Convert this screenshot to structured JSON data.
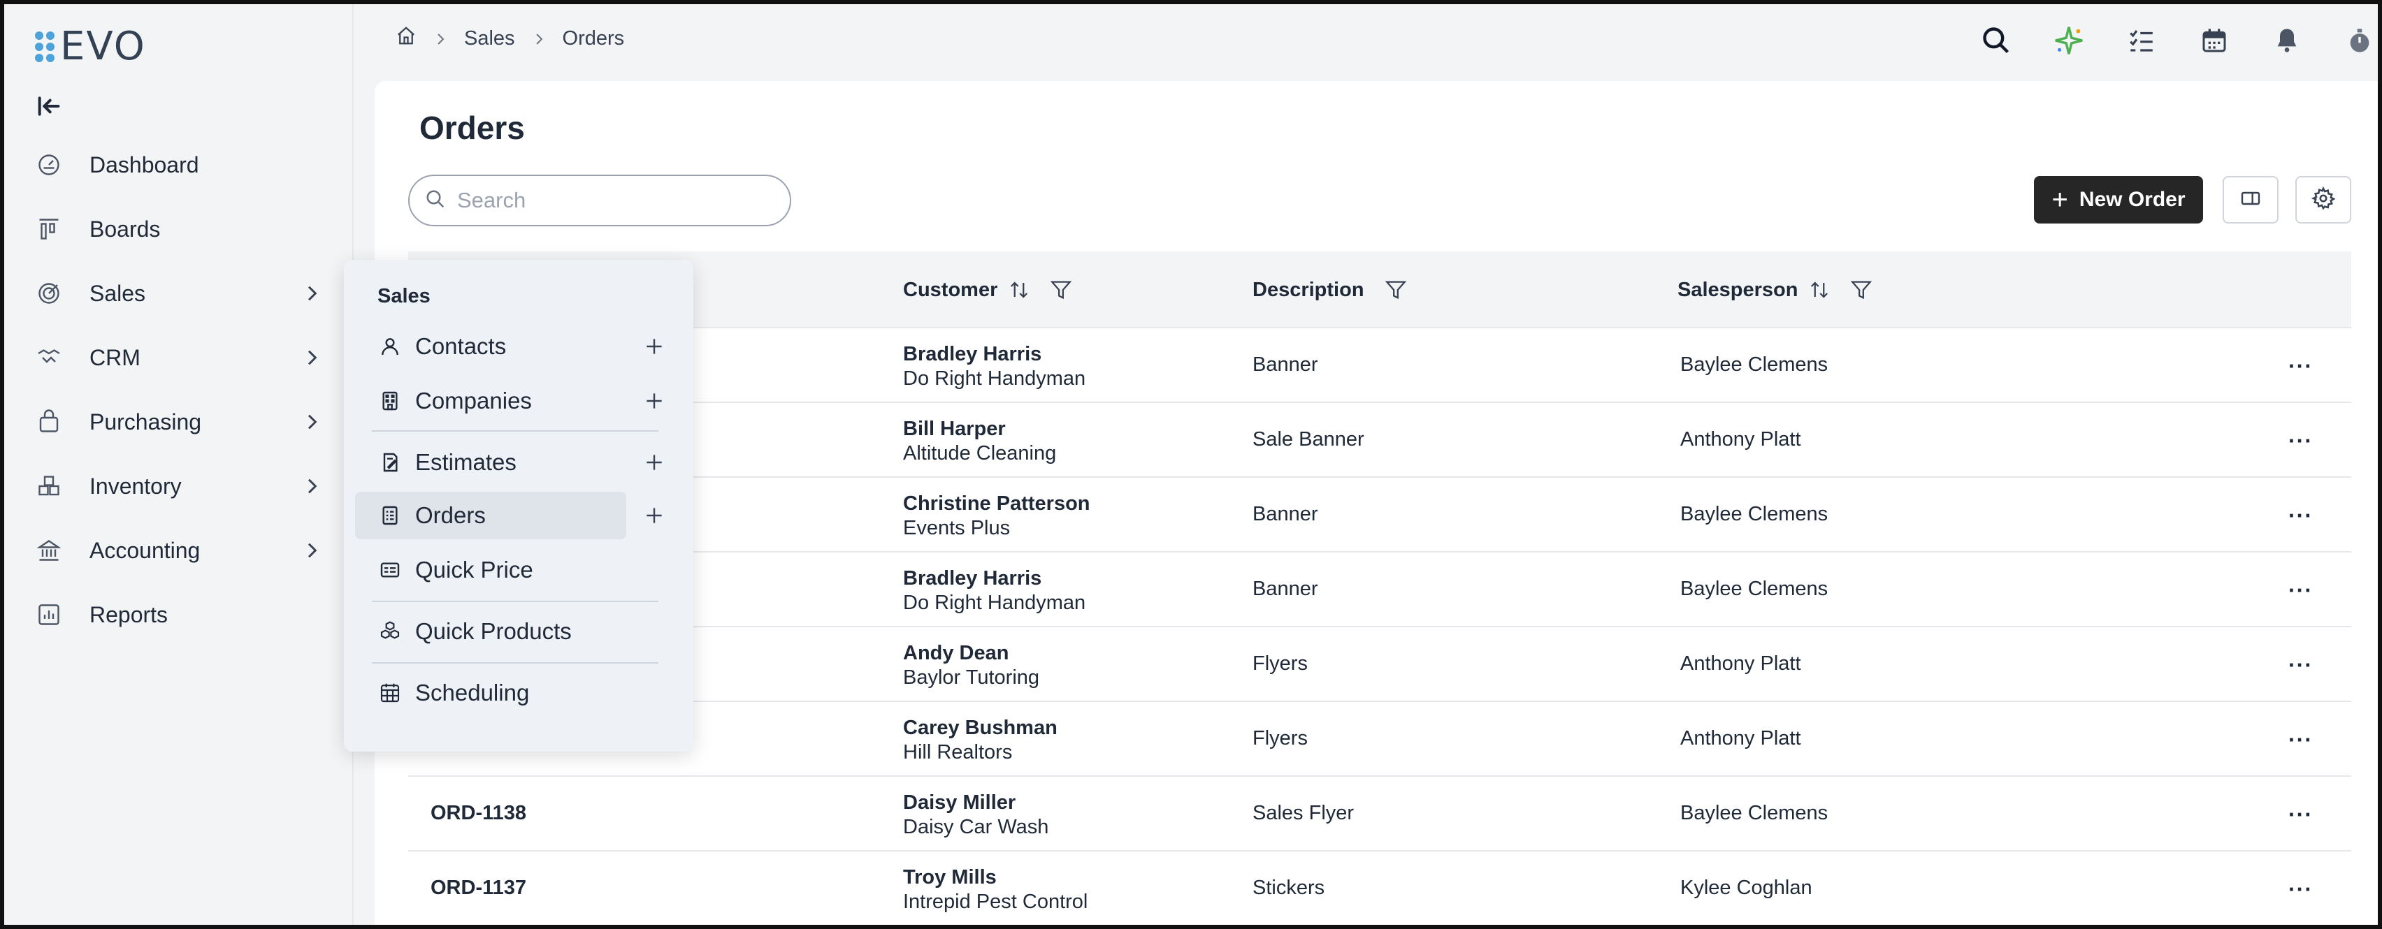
{
  "app": {
    "logo": "EVO"
  },
  "sidebar": {
    "items": [
      {
        "label": "Dashboard",
        "icon": "dashboard-icon"
      },
      {
        "label": "Boards",
        "icon": "boards-icon"
      },
      {
        "label": "Sales",
        "icon": "sales-icon",
        "has_submenu": true
      },
      {
        "label": "CRM",
        "icon": "handshake-icon",
        "has_submenu": true
      },
      {
        "label": "Purchasing",
        "icon": "shopping-bag-icon",
        "has_submenu": true
      },
      {
        "label": "Inventory",
        "icon": "boxes-icon",
        "has_submenu": true
      },
      {
        "label": "Accounting",
        "icon": "bank-icon",
        "has_submenu": true
      },
      {
        "label": "Reports",
        "icon": "chart-icon"
      }
    ]
  },
  "breadcrumb": {
    "items": [
      "Sales",
      "Orders"
    ]
  },
  "page": {
    "title": "Orders"
  },
  "search": {
    "placeholder": "Search",
    "value": ""
  },
  "toolbar": {
    "new_label": "New Order"
  },
  "table": {
    "columns": {
      "customer": "Customer",
      "description": "Description",
      "salesperson": "Salesperson"
    },
    "rows": [
      {
        "id": "",
        "customer": "Bradley Harris",
        "company": "Do Right Handyman",
        "description": "Banner",
        "salesperson": "Baylee Clemens"
      },
      {
        "id": "",
        "customer": "Bill Harper",
        "company": "Altitude Cleaning",
        "description": "Sale Banner",
        "salesperson": "Anthony Platt"
      },
      {
        "id": "",
        "customer": "Christine Patterson",
        "company": "Events Plus",
        "description": "Banner",
        "salesperson": "Baylee Clemens"
      },
      {
        "id": "",
        "customer": "Bradley Harris",
        "company": "Do Right Handyman",
        "description": "Banner",
        "salesperson": "Baylee Clemens"
      },
      {
        "id": "",
        "customer": "Andy Dean",
        "company": "Baylor Tutoring",
        "description": "Flyers",
        "salesperson": "Anthony Platt"
      },
      {
        "id": "",
        "customer": "Carey Bushman",
        "company": "Hill Realtors",
        "description": "Flyers",
        "salesperson": "Anthony Platt"
      },
      {
        "id": "ORD-1138",
        "customer": "Daisy Miller",
        "company": "Daisy Car Wash",
        "description": "Sales Flyer",
        "salesperson": "Baylee Clemens"
      },
      {
        "id": "ORD-1137",
        "customer": "Troy Mills",
        "company": "Intrepid Pest Control",
        "description": "Stickers",
        "salesperson": "Kylee Coghlan"
      }
    ],
    "more_label": "···"
  },
  "flyout": {
    "title": "Sales",
    "items": [
      {
        "label": "Contacts",
        "icon": "person-icon",
        "addable": true
      },
      {
        "label": "Companies",
        "icon": "building-icon",
        "addable": true
      },
      {
        "label": "Estimates",
        "icon": "estimate-icon",
        "addable": true
      },
      {
        "label": "Orders",
        "icon": "order-icon",
        "addable": true,
        "active": true
      },
      {
        "label": "Quick Price",
        "icon": "price-card-icon"
      },
      {
        "label": "Quick Products",
        "icon": "cubes-icon"
      },
      {
        "label": "Scheduling",
        "icon": "calendar-grid-icon"
      }
    ]
  },
  "colors": {
    "accent": "#262626",
    "logo": "#4da3d9",
    "sidebar_bg": "#f3f4f6",
    "flyout_bg": "#eef1f6"
  }
}
